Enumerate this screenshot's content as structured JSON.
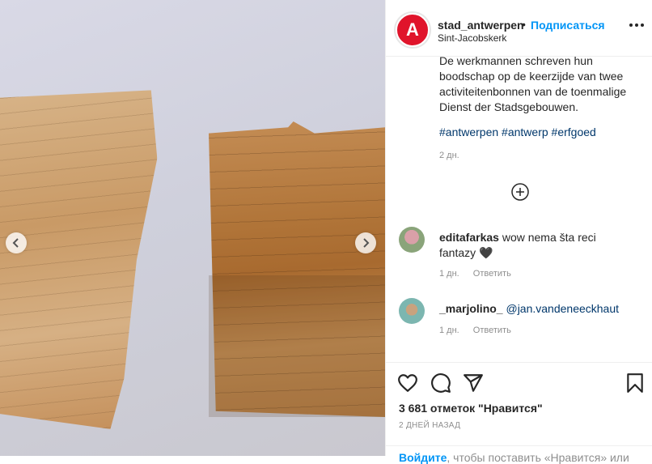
{
  "post": {
    "username": "stad_antwerpen",
    "follow_label": "Подписаться",
    "location": "Sint-Jacobskerk",
    "avatar_letter": "A",
    "caption": "De werkmannen schreven hun boodschap op de keerzijde van twee activiteitenbonnen van de toenmalige Dienst der Stadsgebouwen.",
    "hashtags": "#antwerpen #antwerp #erfgoed",
    "age": "2 дн."
  },
  "comments": [
    {
      "user": "editafarkas",
      "text": "wow nema šta reci fantazy 🖤",
      "age": "1 дн.",
      "reply": "Ответить"
    },
    {
      "user": "_marjolino_",
      "text": "@jan.vandeneeckhaut",
      "age": "1 дн.",
      "reply": "Ответить"
    }
  ],
  "footer": {
    "likes": "3 681 отметок \"Нравится\"",
    "date": "2 ДНЕЙ НАЗАД",
    "login_link": "Войдите",
    "login_text": ", чтобы поставить «Нравится» или"
  },
  "colors": {
    "accent": "#0095f6",
    "brand": "#e0142b",
    "link": "#00376b"
  },
  "icons": [
    "chevron-left-icon",
    "chevron-right-icon",
    "more-icon",
    "plus-circle-icon",
    "heart-icon",
    "comment-icon",
    "share-icon",
    "bookmark-icon"
  ]
}
